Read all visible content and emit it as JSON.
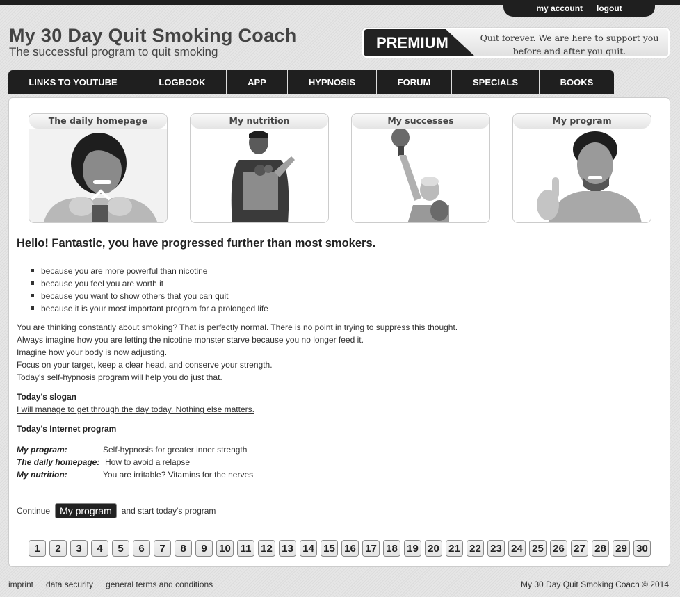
{
  "header": {
    "title": "My 30 Day Quit Smoking Coach",
    "subtitle": "The successful program to quit smoking",
    "account_links": [
      "my account",
      "logout"
    ],
    "premium": {
      "badge": "PREMIUM",
      "text_line1": "Quit forever. We are here to support you",
      "text_line2": "before and after you quit."
    }
  },
  "nav": {
    "items": [
      {
        "label": "LINKS TO YOUTUBE"
      },
      {
        "label": "LOGBOOK"
      },
      {
        "label": "APP"
      },
      {
        "label": "HYPNOSIS"
      },
      {
        "label": "FORUM"
      },
      {
        "label": "SPECIALS"
      },
      {
        "label": "BOOKS"
      }
    ]
  },
  "cards": [
    {
      "title": "The daily homepage",
      "image": "woman-breaking-cigarette"
    },
    {
      "title": "My nutrition",
      "image": "man-with-grocery-bag"
    },
    {
      "title": "My successes",
      "image": "woman-with-boxing-gloves"
    },
    {
      "title": "My program",
      "image": "man-thumbs-up"
    }
  ],
  "content": {
    "headline": "Hello! Fantastic, you have progressed further than most smokers.",
    "bullets": [
      "because you are more powerful than nicotine",
      "because you feel you are worth it",
      "because you want to show others that you can quit",
      "because it is your most important program for a prolonged life"
    ],
    "paragraphs": [
      "You are thinking constantly about smoking? That is perfectly normal. There is no point in trying to suppress this thought.",
      "Always imagine how you are letting the nicotine monster starve because you no longer feed it.",
      "Imagine how your body is now adjusting.",
      "Focus on your target, keep a clear head, and conserve your strength.",
      "Today's self-hypnosis program will help you do just that."
    ],
    "slogan_label": "Today's slogan",
    "slogan": "I will manage to get through the day today. Nothing else matters.",
    "program_label": "Today's Internet program",
    "program_rows": [
      {
        "key": "My program:",
        "value": "Self-hypnosis for greater inner strength"
      },
      {
        "key": "The daily homepage:",
        "value": "How to avoid a relapse"
      },
      {
        "key": "My nutrition:",
        "value": "You are irritable? Vitamins for the nerves"
      }
    ],
    "continue_prefix": "Continue",
    "continue_button": "My program",
    "continue_suffix": "and start today's program"
  },
  "days": [
    "1",
    "2",
    "3",
    "4",
    "5",
    "6",
    "7",
    "8",
    "9",
    "10",
    "11",
    "12",
    "13",
    "14",
    "15",
    "16",
    "17",
    "18",
    "19",
    "20",
    "21",
    "22",
    "23",
    "24",
    "25",
    "26",
    "27",
    "28",
    "29",
    "30"
  ],
  "footer": {
    "links": [
      "imprint",
      "data security",
      "general terms and conditions"
    ],
    "copyright": "My 30 Day Quit Smoking Coach © 2014"
  }
}
